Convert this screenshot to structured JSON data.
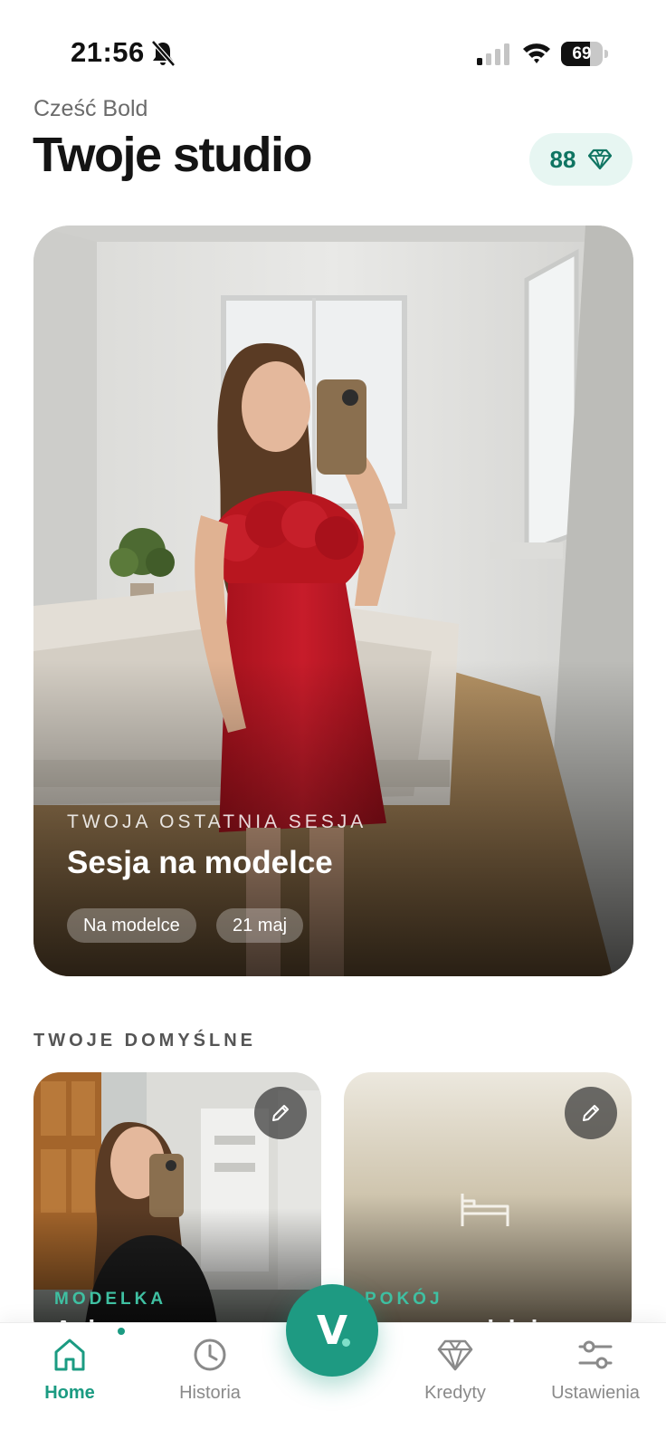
{
  "status_bar": {
    "time": "21:56",
    "battery": "69",
    "battery_percent": 69
  },
  "header": {
    "greeting": "Cześć Bold",
    "title": "Twoje studio",
    "credits": "88"
  },
  "last_session": {
    "label": "TWOJA OSTATNIA SESJA",
    "title": "Sesja na modelce",
    "type_chip": "Na modelce",
    "date_chip": "21 maj"
  },
  "defaults": {
    "section_label": "TWOJE DOMYŚLNE",
    "cards": [
      {
        "label": "MODELKA",
        "name": "Ania"
      },
      {
        "label": "POKÓJ",
        "name": "Jasna sypialnia"
      }
    ]
  },
  "bottom_nav": {
    "items": [
      {
        "label": "Home",
        "icon": "home-icon"
      },
      {
        "label": "Historia",
        "icon": "clock-icon"
      },
      {
        "label": "Kredyty",
        "icon": "diamond-icon"
      },
      {
        "label": "Ustawienia",
        "icon": "sliders-icon"
      }
    ],
    "center_button": "V"
  },
  "colors": {
    "accent": "#1e9a82",
    "accent_light": "#e7f6f2",
    "label_green": "#3fc0a2"
  }
}
